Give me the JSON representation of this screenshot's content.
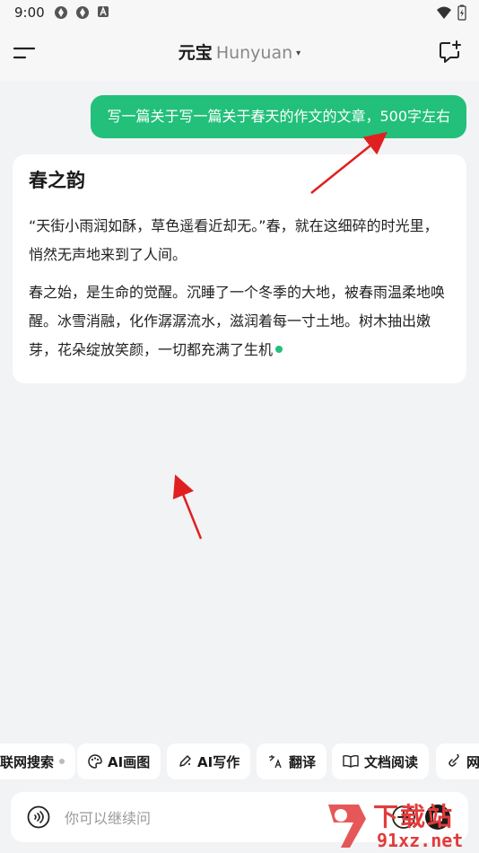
{
  "status_bar": {
    "time": "9:00"
  },
  "header": {
    "title_main": "元宝",
    "title_sub": "Hunyuan",
    "caret": "▾"
  },
  "user_message": "写一篇关于写一篇关于春天的作文的文章，500字左右",
  "answer": {
    "title": "春之韵",
    "paragraph_1": "“天街小雨润如酥，草色遥看近却无。”春，就在这细碎的时光里，悄然无声地来到了人间。",
    "paragraph_2": "春之始，是生命的觉醒。沉睡了一个冬季的大地，被春雨温柔地唤醒。冰雪消融，化作潺潺流水，滋润着每一寸土地。树木抽出嫩芽，花朵绽放笑颜，一切都充满了生机"
  },
  "chips": [
    {
      "label": "联网搜索",
      "icon": "dot-icon"
    },
    {
      "label": "AI画图",
      "icon": "palette-icon"
    },
    {
      "label": "AI写作",
      "icon": "pen-icon"
    },
    {
      "label": "翻译",
      "icon": "translate-icon"
    },
    {
      "label": "文档阅读",
      "icon": "book-icon"
    },
    {
      "label": "网",
      "icon": "link-icon"
    }
  ],
  "input": {
    "placeholder": "你可以继续问"
  },
  "watermark": {
    "line1": "下载站",
    "line2": "91xz.net"
  },
  "colors": {
    "accent": "#22c07a",
    "annotation": "#e02020",
    "background": "#f2f3f5"
  }
}
